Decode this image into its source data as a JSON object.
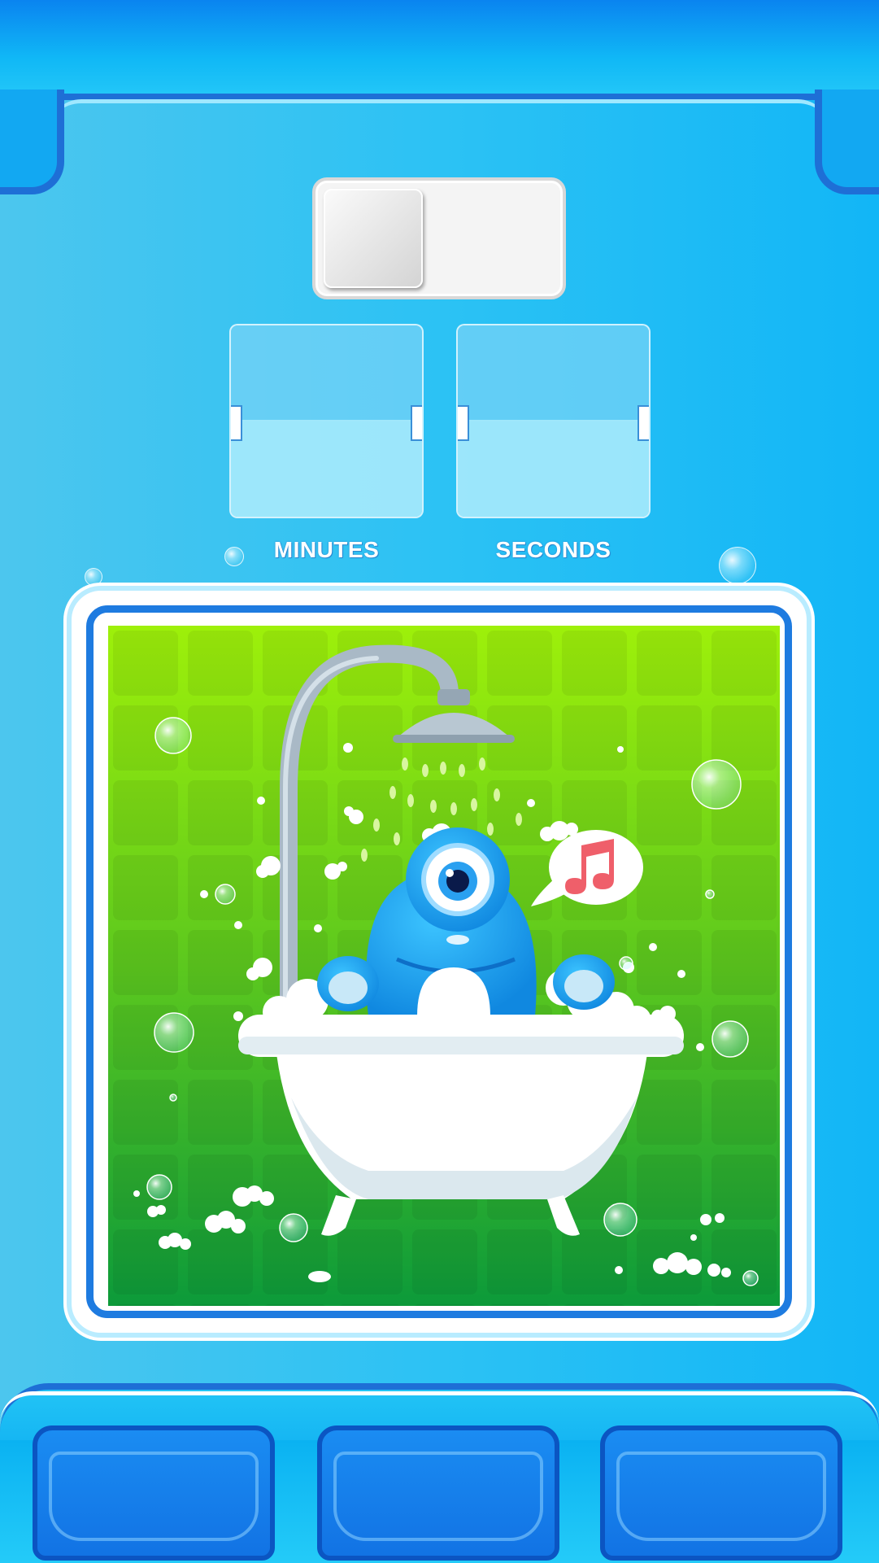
{
  "timer": {
    "minutes_label": "MINUTES",
    "seconds_label": "SECONDS",
    "minutes_value": "",
    "seconds_value": ""
  },
  "toggle": {
    "state": "off"
  },
  "scene": {
    "subject": "monster-in-bathtub",
    "speech_icon": "music-note-icon"
  },
  "nav": {
    "left_label": "",
    "middle_label": "",
    "right_label": ""
  },
  "colors": {
    "accent": "#1e6fd6",
    "scene_green_top": "#9ef00a",
    "scene_green_bottom": "#0c9a3a",
    "monster": "#18a6ee",
    "music_note": "#ef5f6a"
  }
}
